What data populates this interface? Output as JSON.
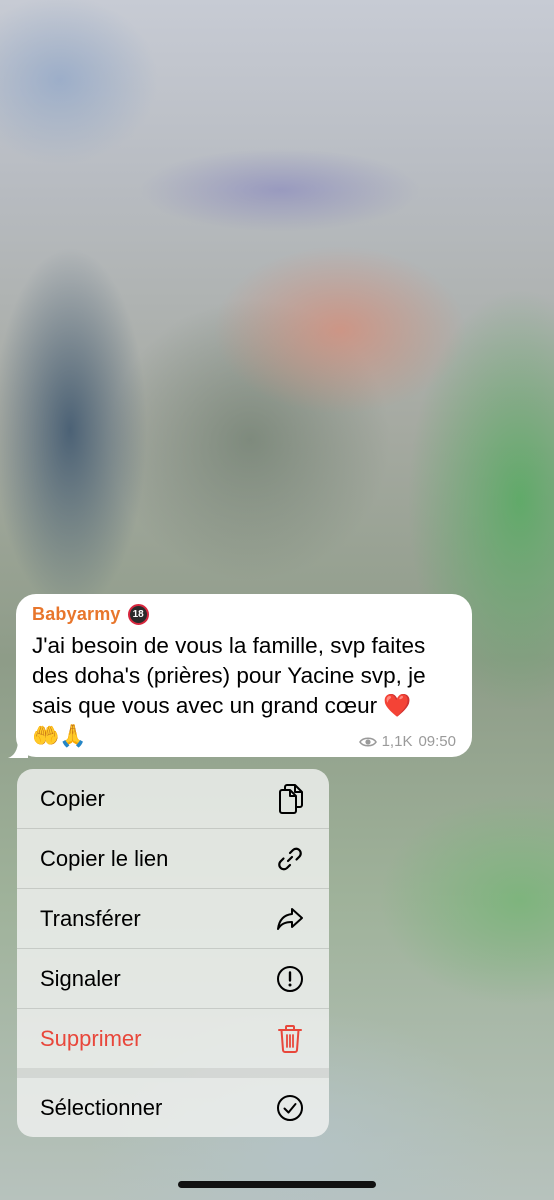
{
  "message": {
    "sender": "Babyarmy",
    "sender_badge": "18",
    "text": "J'ai besoin de vous la famille, svp faites des doha's (prières) pour Yacine svp, je sais que vous avec un grand cœur ❤️",
    "emoji_line": "🤲🙏",
    "views": "1,1K",
    "time": "09:50",
    "sender_color": "#e8762c"
  },
  "menu": {
    "items": [
      {
        "label": "Copier",
        "icon": "copy-icon"
      },
      {
        "label": "Copier le lien",
        "icon": "link-icon"
      },
      {
        "label": "Transférer",
        "icon": "forward-icon"
      },
      {
        "label": "Signaler",
        "icon": "report-icon"
      },
      {
        "label": "Supprimer",
        "icon": "trash-icon",
        "danger": true,
        "color": "#e8473b"
      },
      {
        "label": "Sélectionner",
        "icon": "select-check-icon"
      }
    ]
  }
}
